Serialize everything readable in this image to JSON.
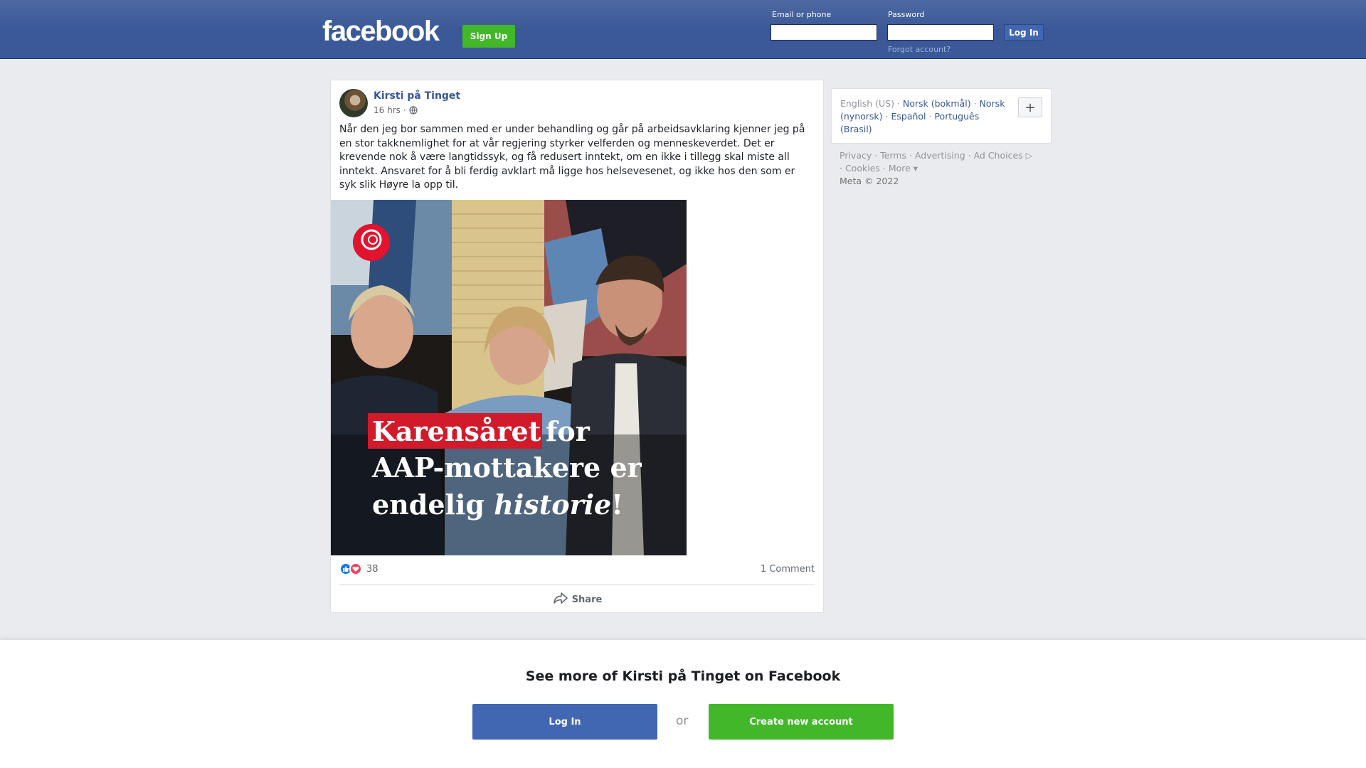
{
  "header": {
    "logo": "facebook",
    "signup_label": "Sign Up",
    "email_label": "Email or phone",
    "password_label": "Password",
    "login_label": "Log In",
    "forgot_label": "Forgot account?"
  },
  "post": {
    "author": "Kirsti på Tinget",
    "time": "16 hrs",
    "visibility_icon": "globe-icon",
    "text": "Når den jeg bor sammen med er under behandling og går på arbeidsavklaring kjenner jeg på en stor takknemlighet for at vår regjering styrker velferden og menneskeverdet. Det er krevende nok å være langtidssyk, og få redusert inntekt, om en ikke i tillegg skal miste all inntekt. Ansvaret for å bli ferdig avklart må ligge hos helsevesenet, og ikke hos den som er syk slik Høyre la opp til.",
    "image": {
      "headline_highlight": "Karensåret",
      "headline_line1_rest": "for",
      "headline_line2": "AAP-mottakere er",
      "headline_line3_plain": "endelig",
      "headline_line3_italic": "historie",
      "headline_line3_end": "!"
    },
    "reaction_count": "38",
    "comment_count": "1 Comment",
    "share_label": "Share"
  },
  "sidebar": {
    "languages": [
      {
        "label": "English (US)",
        "active": true
      },
      {
        "label": "Norsk (bokmål)",
        "active": false
      },
      {
        "label": "Norsk (nynorsk)",
        "active": false
      },
      {
        "label": "Español",
        "active": false
      },
      {
        "label": "Português (Brasil)",
        "active": false
      }
    ],
    "add_language": "+",
    "footer": {
      "privacy": "Privacy",
      "terms": "Terms",
      "advertising": "Advertising",
      "ad_choices": "Ad Choices",
      "cookies": "Cookies",
      "more": "More",
      "copyright": "Meta © 2022"
    }
  },
  "bottom": {
    "title": "See more of Kirsti på Tinget on Facebook",
    "login_label": "Log In",
    "or_label": "or",
    "create_label": "Create new account"
  },
  "colors": {
    "header_blue": "#3b5998",
    "link_blue": "#385898",
    "green": "#42b72a"
  }
}
